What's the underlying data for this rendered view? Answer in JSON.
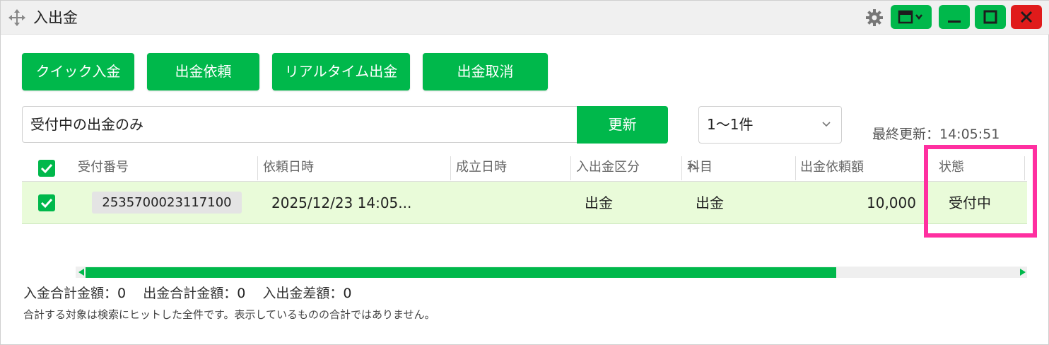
{
  "window": {
    "title": "入出金"
  },
  "titlebar_icons": [
    "move-icon",
    "gear-icon",
    "layout-icon",
    "minimize-icon",
    "maximize-icon",
    "close-icon"
  ],
  "actions": [
    {
      "label": "クイック入金"
    },
    {
      "label": "出金依頼"
    },
    {
      "label": "リアルタイム出金"
    },
    {
      "label": "出金取消"
    }
  ],
  "filter": {
    "value": "受付中の出金のみ",
    "update_label": "更新",
    "page_select": "1〜1件",
    "last_update": "最終更新：14:05:51"
  },
  "table": {
    "headers": [
      "受付番号",
      "依頼日時",
      "成立日時",
      "入出金区分",
      "科目",
      "出金依頼額",
      "状態"
    ],
    "rows": [
      {
        "checked": true,
        "receipt_no": "2535700023117100",
        "request_datetime": "2025/12/23 14:05...",
        "established_datetime": "",
        "type": "出金",
        "subject": "出金",
        "amount": "10,000",
        "status": "受付中"
      }
    ]
  },
  "scroll": {
    "position": 0.0,
    "visible_fraction": 0.79
  },
  "summary": {
    "deposit_label": "入金合計金額：",
    "deposit_value": "0",
    "withdraw_label": "出金合計金額：",
    "withdraw_value": "0",
    "diff_label": "入出金差額：",
    "diff_value": "0",
    "note": "合計する対象は検索にヒットした全件です。表示しているものの合計ではありません。"
  },
  "colors": {
    "accent": "#00b84b",
    "close": "#e01b1b",
    "highlight": "#ff2fa0",
    "row_bg": "#e9fbd9"
  }
}
